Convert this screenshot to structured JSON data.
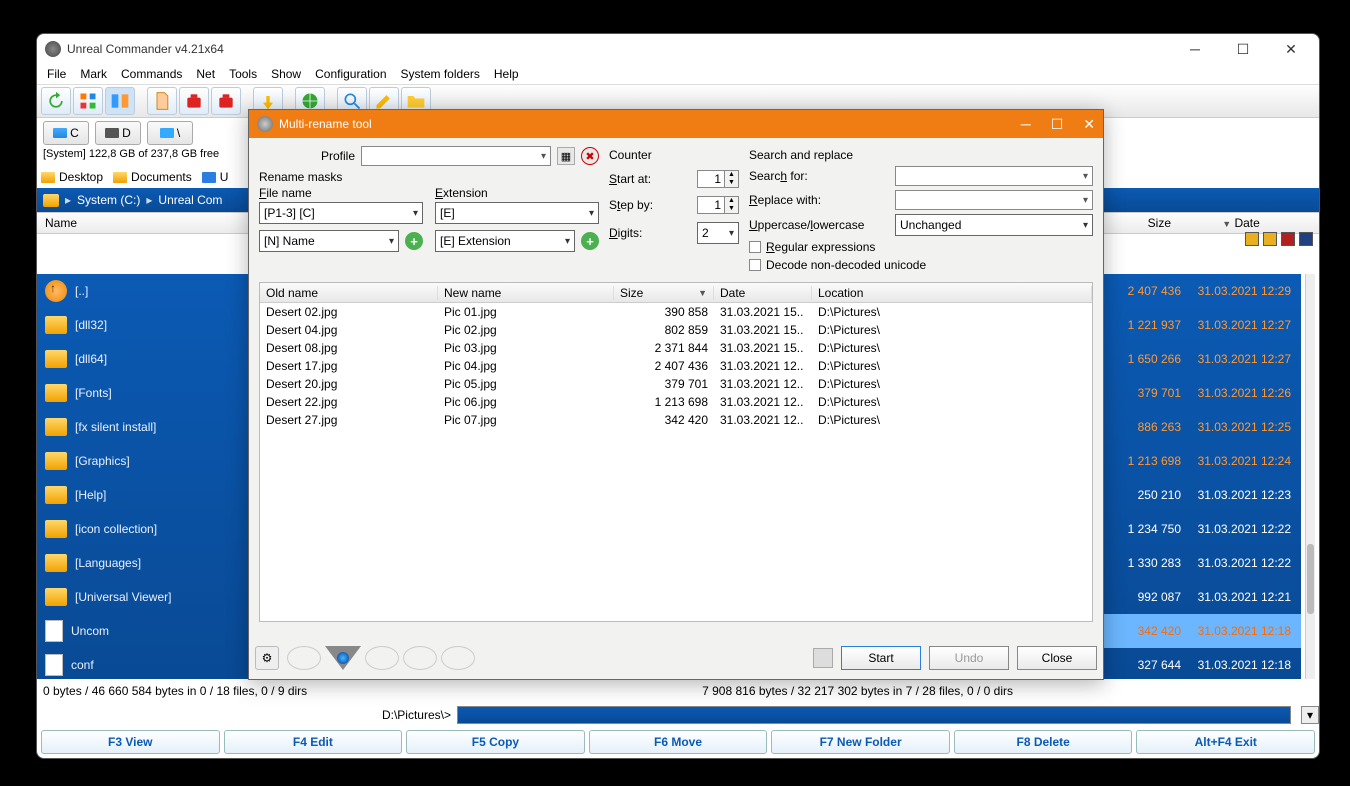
{
  "mainWindow": {
    "title": "Unreal Commander v4.21x64",
    "menu": [
      "File",
      "Mark",
      "Commands",
      "Net",
      "Tools",
      "Show",
      "Configuration",
      "System folders",
      "Help"
    ],
    "drives": {
      "c": "C",
      "d": "D",
      "net": "\\"
    },
    "freespace": "[System]  122,8 GB of 237,8 GB free",
    "tabs": {
      "desktop": "Desktop",
      "docs": "Documents",
      "u": "U"
    },
    "breadcrumb": {
      "a": "System (C:)",
      "b": "Unreal Com"
    },
    "leftHeader": "Name",
    "rightHeaderSize": "Size",
    "rightHeaderDate": "Date",
    "leftItems": [
      {
        "type": "up",
        "label": "[..]"
      },
      {
        "type": "folder",
        "label": "[dll32]"
      },
      {
        "type": "folder",
        "label": "[dll64]"
      },
      {
        "type": "folder",
        "label": "[Fonts]"
      },
      {
        "type": "folder",
        "label": "[fx silent install]"
      },
      {
        "type": "folder",
        "label": "[Graphics]"
      },
      {
        "type": "folder",
        "label": "[Help]"
      },
      {
        "type": "folder",
        "label": "[icon collection]"
      },
      {
        "type": "folder",
        "label": "[Languages]"
      },
      {
        "type": "folder",
        "label": "[Universal Viewer]"
      },
      {
        "type": "file",
        "label": "Uncom"
      },
      {
        "type": "file",
        "label": "conf"
      }
    ],
    "rightItems": [
      {
        "size": "2 407 436",
        "date": "31.03.2021 12:29",
        "orange": true
      },
      {
        "size": "1 221 937",
        "date": "31.03.2021 12:27",
        "orange": true
      },
      {
        "size": "1 650 266",
        "date": "31.03.2021 12:27",
        "orange": true
      },
      {
        "size": "379 701",
        "date": "31.03.2021 12:26",
        "orange": true
      },
      {
        "size": "886 263",
        "date": "31.03.2021 12:25",
        "orange": true
      },
      {
        "size": "1 213 698",
        "date": "31.03.2021 12:24",
        "orange": true
      },
      {
        "size": "250 210",
        "date": "31.03.2021 12:23"
      },
      {
        "size": "1 234 750",
        "date": "31.03.2021 12:22"
      },
      {
        "size": "1 330 283",
        "date": "31.03.2021 12:22"
      },
      {
        "size": "992 087",
        "date": "31.03.2021 12:21"
      },
      {
        "size": "342 420",
        "date": "31.03.2021 12:18",
        "sel": true,
        "orange": true
      },
      {
        "size": "327 644",
        "date": "31.03.2021 12:18"
      }
    ],
    "statusLeft": "0 bytes / 46 660 584 bytes in 0 / 18 files, 0 / 9 dirs",
    "statusRight": "7 908 816 bytes / 32 217 302 bytes in 7 / 28 files, 0 / 0 dirs",
    "pathLabel": "D:\\Pictures\\>",
    "fkeys": [
      "F3 View",
      "F4 Edit",
      "F5 Copy",
      "F6 Move",
      "F7 New Folder",
      "F8 Delete",
      "Alt+F4 Exit"
    ]
  },
  "dialog": {
    "title": "Multi-rename tool",
    "profileLabel": "Profile",
    "renameMasks": "Rename masks",
    "fileNameLabel": "File name",
    "fileNameValue": "[P1-3] [C]",
    "nameDropdown": "[N] Name",
    "extLabel": "Extension",
    "extValue": "[E]",
    "extDropdown": "[E] Extension",
    "counter": "Counter",
    "startAt": "Start at:",
    "startAtVal": "1",
    "stepBy": "Step by:",
    "stepByVal": "1",
    "digits": "Digits:",
    "digitsVal": "2",
    "searchReplace": "Search and replace",
    "searchFor": "Search for:",
    "replaceWith": "Replace with:",
    "caseLabel": "Uppercase/lowercase",
    "caseValue": "Unchanged",
    "regex": "Regular expressions",
    "decode": "Decode non-decoded unicode",
    "gridHeaders": {
      "old": "Old name",
      "new": "New name",
      "size": "Size",
      "date": "Date",
      "loc": "Location"
    },
    "rows": [
      {
        "old": "Desert 02.jpg",
        "new": "Pic 01.jpg",
        "size": "390 858",
        "date": "31.03.2021 15..",
        "loc": "D:\\Pictures\\"
      },
      {
        "old": "Desert 04.jpg",
        "new": "Pic 02.jpg",
        "size": "802 859",
        "date": "31.03.2021 15..",
        "loc": "D:\\Pictures\\"
      },
      {
        "old": "Desert 08.jpg",
        "new": "Pic 03.jpg",
        "size": "2 371 844",
        "date": "31.03.2021 15..",
        "loc": "D:\\Pictures\\"
      },
      {
        "old": "Desert 17.jpg",
        "new": "Pic 04.jpg",
        "size": "2 407 436",
        "date": "31.03.2021 12..",
        "loc": "D:\\Pictures\\"
      },
      {
        "old": "Desert 20.jpg",
        "new": "Pic 05.jpg",
        "size": "379 701",
        "date": "31.03.2021 12..",
        "loc": "D:\\Pictures\\"
      },
      {
        "old": "Desert 22.jpg",
        "new": "Pic 06.jpg",
        "size": "1 213 698",
        "date": "31.03.2021 12..",
        "loc": "D:\\Pictures\\"
      },
      {
        "old": "Desert 27.jpg",
        "new": "Pic 07.jpg",
        "size": "342 420",
        "date": "31.03.2021 12..",
        "loc": "D:\\Pictures\\"
      }
    ],
    "buttons": {
      "start": "Start",
      "undo": "Undo",
      "close": "Close"
    }
  }
}
